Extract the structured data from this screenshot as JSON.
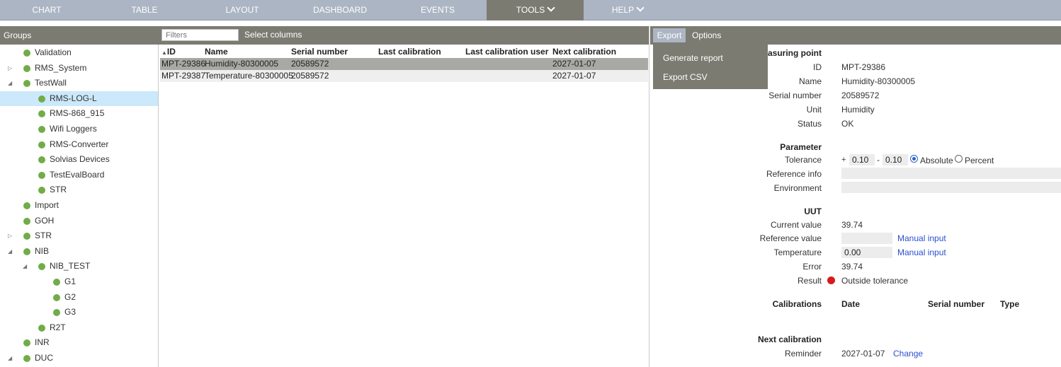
{
  "nav": {
    "items": [
      "CHART",
      "TABLE",
      "LAYOUT",
      "DASHBOARD",
      "EVENTS",
      "TOOLS",
      "HELP"
    ],
    "active": "TOOLS"
  },
  "groups": {
    "title": "Groups",
    "items": [
      {
        "label": "Validation"
      },
      {
        "label": "RMS_System"
      },
      {
        "label": "TestWall"
      },
      {
        "label": "RMS-LOG-L"
      },
      {
        "label": "RMS-868_915"
      },
      {
        "label": "Wifi Loggers"
      },
      {
        "label": "RMS-Converter"
      },
      {
        "label": "Solvias Devices"
      },
      {
        "label": "TestEvalBoard"
      },
      {
        "label": "STR"
      },
      {
        "label": "Import"
      },
      {
        "label": "GOH"
      },
      {
        "label": "STR"
      },
      {
        "label": "NIB"
      },
      {
        "label": "NIB_TEST"
      },
      {
        "label": "G1"
      },
      {
        "label": "G2"
      },
      {
        "label": "G3"
      },
      {
        "label": "R2T"
      },
      {
        "label": "INR"
      },
      {
        "label": "DUC"
      }
    ],
    "selected": "RMS-LOG-L",
    "status_color": "#70ad47"
  },
  "table": {
    "filter_placeholder": "Filters",
    "select_columns": "Select columns",
    "columns": [
      "ID",
      "Name",
      "Serial number",
      "Last calibration",
      "Last calibration user",
      "Next calibration"
    ],
    "rows": [
      {
        "id": "MPT-29386",
        "name": "Humidity-80300005",
        "serial": "20589572",
        "last_cal": "",
        "last_cal_user": "",
        "next_cal": "2027-01-07"
      },
      {
        "id": "MPT-29387",
        "name": "Temperature-80300005",
        "serial": "20589572",
        "last_cal": "",
        "last_cal_user": "",
        "next_cal": "2027-01-07"
      }
    ]
  },
  "details": {
    "tabs": {
      "export": "Export",
      "options": "Options"
    },
    "export_menu": [
      "Generate report",
      "Export CSV"
    ],
    "measuring_point_heading": "easuring point",
    "fields": {
      "id_label": "ID",
      "id": "MPT-29386",
      "name_label": "Name",
      "name": "Humidity-80300005",
      "serial_label": "Serial number",
      "serial": "20589572",
      "unit_label": "Unit",
      "unit": "Humidity",
      "status_label": "Status",
      "status": "OK"
    },
    "parameter": {
      "heading": "Parameter",
      "tolerance_label": "Tolerance",
      "plus_sign": "+",
      "plus_value": "0.10",
      "minus_sign": "-",
      "minus_value": "0.10",
      "absolute_label": "Absolute",
      "percent_label": "Percent",
      "reference_info_label": "Reference info",
      "environment_label": "Environment"
    },
    "uut": {
      "heading": "UUT",
      "current_value_label": "Current value",
      "current_value": "39.74",
      "reference_value_label": "Reference value",
      "reference_value": "",
      "temperature_label": "Temperature",
      "temperature": "0.00",
      "manual_input": "Manual input",
      "error_label": "Error",
      "error": "39.74",
      "result_label": "Result",
      "result": "Outside tolerance",
      "result_color": "#d71b1b"
    },
    "calibrations": {
      "heading": "Calibrations",
      "columns": [
        "Date",
        "Serial number",
        "Type"
      ]
    },
    "next_calibration": {
      "heading": "Next calibration",
      "reminder_label": "Reminder",
      "reminder": "2027-01-07",
      "change": "Change"
    }
  },
  "colors": {
    "nav_bg": "#acb5c3",
    "header_bg": "#7c7b72",
    "selected_tree": "#cce8fb",
    "link": "#2b4fcf"
  }
}
